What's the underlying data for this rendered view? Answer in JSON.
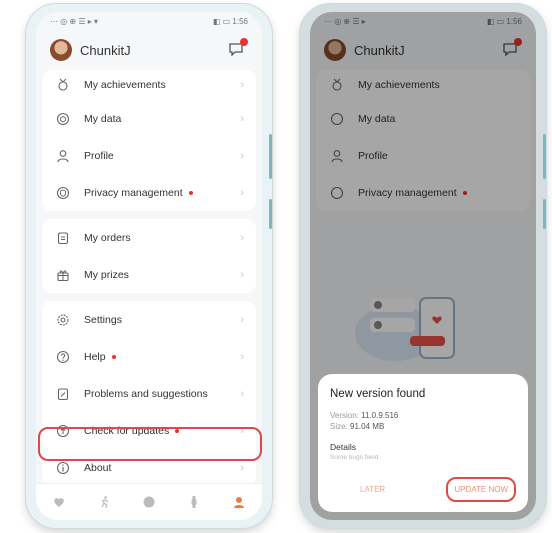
{
  "left_phone": {
    "status_left": "⋯ ◎ ⊕ ☰ ▸ ▾",
    "status_right": "◧ ▭ 1:56",
    "username": "ChunkitJ",
    "menu_group1": [
      {
        "label": "My achievements",
        "icon": "medal-icon"
      },
      {
        "label": "My data",
        "icon": "cube-icon"
      },
      {
        "label": "Profile",
        "icon": "person-icon"
      },
      {
        "label": "Privacy management",
        "icon": "shield-icon",
        "dot": true
      }
    ],
    "menu_group2": [
      {
        "label": "My orders",
        "icon": "orders-icon"
      },
      {
        "label": "My prizes",
        "icon": "gift-icon"
      }
    ],
    "menu_group3": [
      {
        "label": "Settings",
        "icon": "gear-icon"
      },
      {
        "label": "Help",
        "icon": "help-icon",
        "dot": true
      },
      {
        "label": "Problems and suggestions",
        "icon": "feedback-icon"
      },
      {
        "label": "Check for updates",
        "icon": "update-icon",
        "dot": true
      },
      {
        "label": "About",
        "icon": "info-icon"
      }
    ],
    "chevron": "›"
  },
  "right_phone": {
    "status_left": "⋯ ◎ ⊕ ☰ ▸",
    "status_right": "◧ ▭ 1:56",
    "username": "ChunkitJ",
    "menu": [
      {
        "label": "My achievements",
        "icon": "medal-icon"
      },
      {
        "label": "My data",
        "icon": "cube-icon"
      },
      {
        "label": "Profile",
        "icon": "person-icon"
      },
      {
        "label": "Privacy management",
        "icon": "shield-icon",
        "dot": true
      }
    ],
    "dialog": {
      "title": "New version found",
      "version_label": "Version:",
      "version_value": "11.0.9.516",
      "size_label": "Size:",
      "size_value": "91.04 MB",
      "details_label": "Details",
      "details_text": "Some bugs fixed.",
      "later": "LATER",
      "update_now": "UPDATE NOW"
    }
  },
  "colors": {
    "accent_red": "#e14a43",
    "dot_red": "#e8322f",
    "update_text": "#f08c72"
  }
}
